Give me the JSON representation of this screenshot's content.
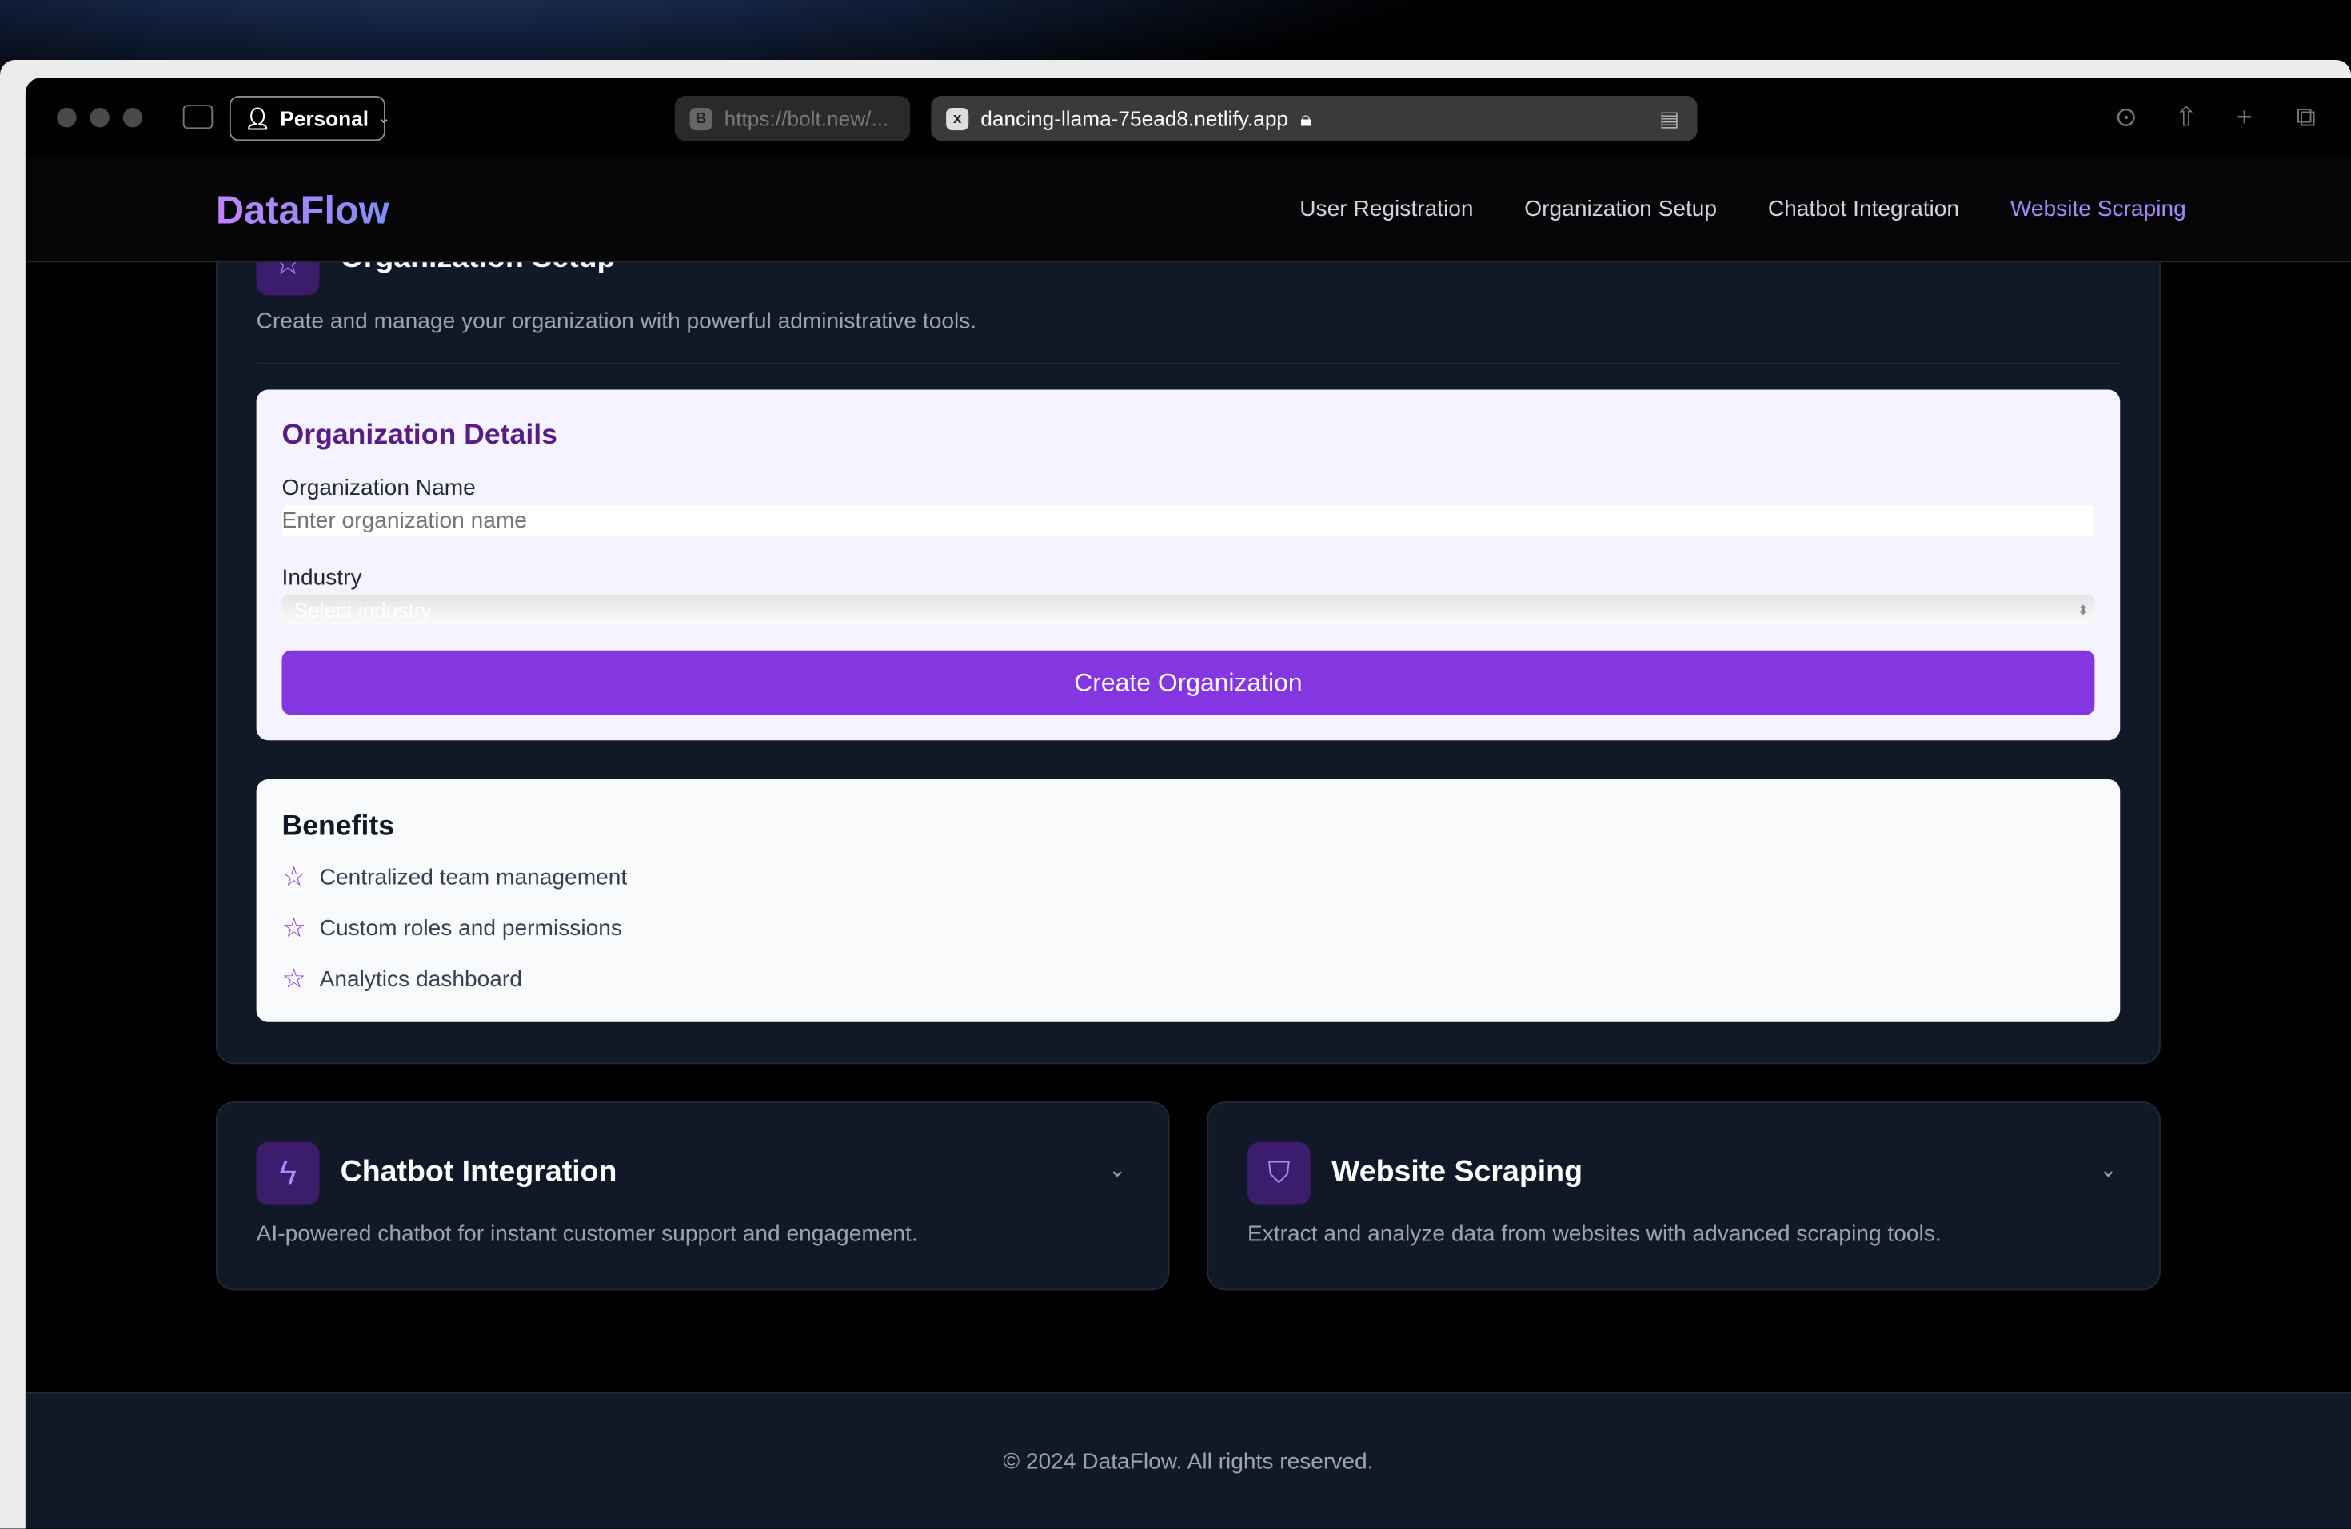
{
  "browser": {
    "profile_label": "Personal",
    "tabs": [
      {
        "label": "https://bolt.new/...",
        "favicon": "B"
      },
      {
        "label": "dancing-llama-75ead8.netlify.app",
        "favicon": "x"
      }
    ]
  },
  "site": {
    "logo": "DataFlow",
    "nav": [
      "User Registration",
      "Organization Setup",
      "Chatbot Integration",
      "Website Scraping"
    ],
    "active_nav": "Website Scraping",
    "accent_color": "#8436e0"
  },
  "org_section": {
    "title": "Organization Setup",
    "description": "Create and manage your organization with powerful administrative tools.",
    "details": {
      "heading": "Organization Details",
      "name_label": "Organization Name",
      "name_placeholder": "Enter organization name",
      "industry_label": "Industry",
      "industry_placeholder": "Select industry",
      "submit": "Create Organization"
    },
    "benefits": {
      "heading": "Benefits",
      "items": [
        "Centralized team management",
        "Custom roles and permissions",
        "Analytics dashboard"
      ]
    }
  },
  "cards": [
    {
      "title": "Chatbot Integration",
      "description": "AI-powered chatbot for instant customer support and engagement.",
      "icon": "lightning-icon"
    },
    {
      "title": "Website Scraping",
      "description": "Extract and analyze data from websites with advanced scraping tools.",
      "icon": "shield-icon"
    }
  ],
  "footer": "© 2024 DataFlow. All rights reserved."
}
